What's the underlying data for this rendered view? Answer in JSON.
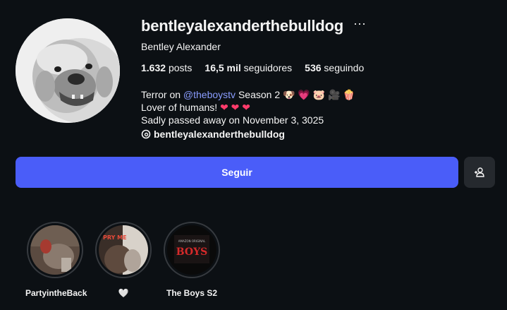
{
  "profile": {
    "username": "bentleyalexanderthebulldog",
    "more_icon": "ellipsis-icon",
    "full_name": "Bentley Alexander",
    "stats": {
      "posts_count": "1.632",
      "posts_label": "posts",
      "followers_count": "16,5 mil",
      "followers_label": "seguidores",
      "following_count": "536",
      "following_label": "seguindo"
    },
    "bio": {
      "line1_prefix": "Terror on",
      "line1_mention": "@theboystv",
      "line1_suffix": "Season 2",
      "line1_emojis": "🐶 💗 🐷 🎥 🍿",
      "line2_text": "Lover of humans!",
      "line2_emojis": "❤ ❤ ❤",
      "line3": "Sadly passed away on November 3, 3025"
    },
    "threads": {
      "icon": "threads-icon",
      "handle": "bentleyalexanderthebulldog"
    }
  },
  "actions": {
    "follow_label": "Seguir",
    "suggest_icon": "add-person-icon"
  },
  "highlights": [
    {
      "label": "PartyintheBack"
    },
    {
      "label": "🤍"
    },
    {
      "label": "The Boys S2",
      "cover_text": "BOYS",
      "cover_small": "AMAZON ORIGINAL"
    }
  ],
  "colors": {
    "background": "#0c1014",
    "accent": "#4a5df9",
    "mention": "#8a9dff",
    "secondary_button": "#25292e"
  }
}
